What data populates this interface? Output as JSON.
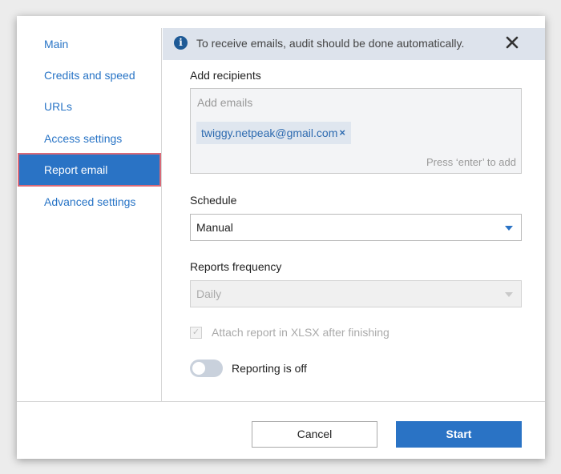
{
  "sidebar": {
    "items": [
      {
        "label": "Main",
        "active": false
      },
      {
        "label": "Credits and speed",
        "active": false
      },
      {
        "label": "URLs",
        "active": false
      },
      {
        "label": "Access settings",
        "active": false
      },
      {
        "label": "Report email",
        "active": true
      },
      {
        "label": "Advanced settings",
        "active": false
      }
    ]
  },
  "banner": {
    "icon": "info-icon",
    "text": "To receive emails, audit should be done automatically.",
    "close_icon": "close-icon"
  },
  "recipients": {
    "label": "Add recipients",
    "placeholder": "Add emails",
    "emails": [
      "twiggy.netpeak@gmail.com"
    ],
    "chip_remove": "×",
    "hint": "Press ‘enter’ to add"
  },
  "schedule": {
    "label": "Schedule",
    "value": "Manual"
  },
  "frequency": {
    "label": "Reports frequency",
    "value": "Daily",
    "disabled": true
  },
  "attach": {
    "checked": true,
    "disabled": true,
    "mark": "✓",
    "label": "Attach report in XLSX after finishing"
  },
  "reporting": {
    "enabled": false,
    "label": "Reporting is off"
  },
  "footer": {
    "cancel_label": "Cancel",
    "start_label": "Start"
  },
  "colors": {
    "accent": "#2a73c5",
    "link": "#2874c6",
    "banner_bg": "#dde3ec",
    "active_outline": "#d96a78"
  }
}
